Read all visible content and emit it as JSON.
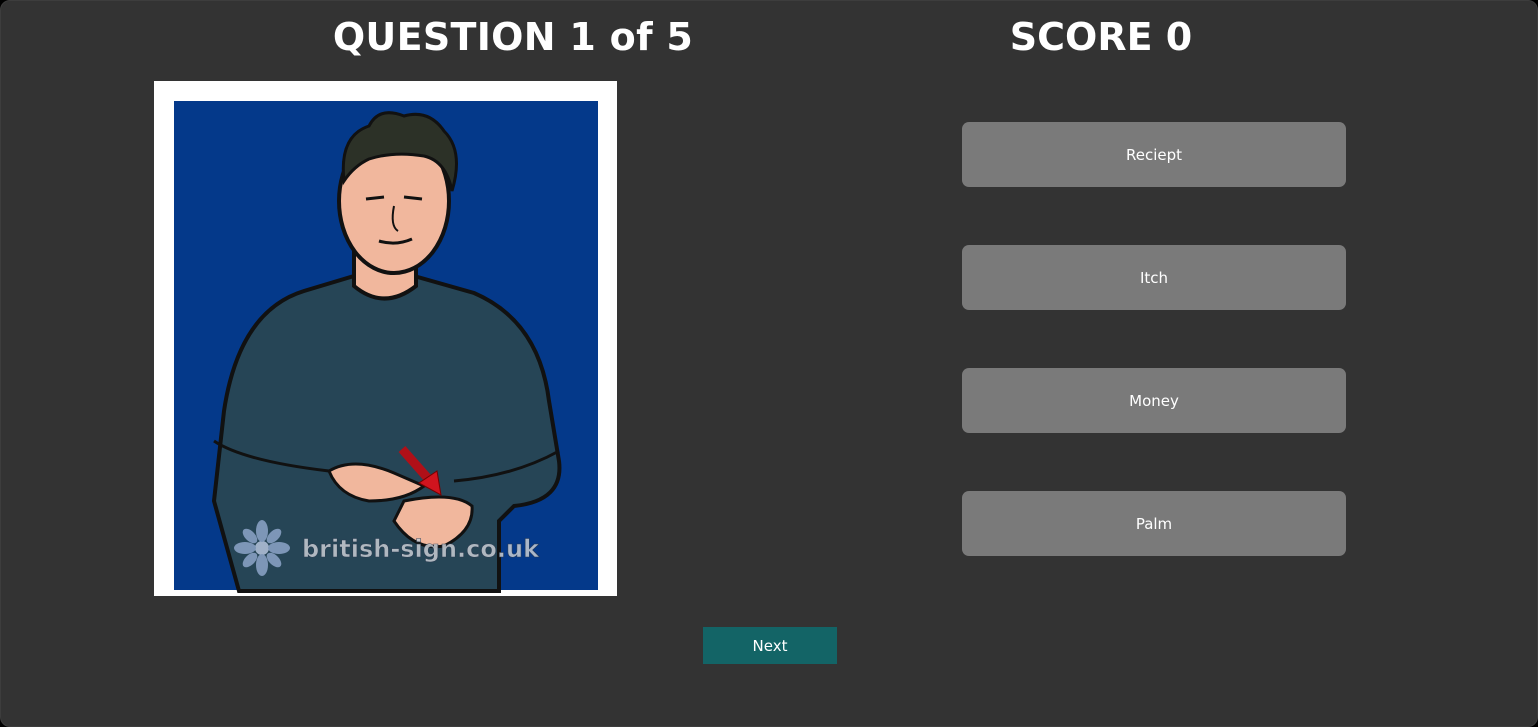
{
  "header": {
    "question_label": "QUESTION 1 of 5",
    "score_label": "SCORE 0"
  },
  "sign_image": {
    "watermark": "british-sign.co.uk",
    "background_color": "#04398a"
  },
  "answers": [
    {
      "label": "Reciept"
    },
    {
      "label": "Itch"
    },
    {
      "label": "Money"
    },
    {
      "label": "Palm"
    }
  ],
  "next_button": {
    "label": "Next"
  },
  "colors": {
    "background": "#333333",
    "answer_button": "#7a7a7a",
    "next_button": "#136466",
    "text": "#ffffff"
  }
}
